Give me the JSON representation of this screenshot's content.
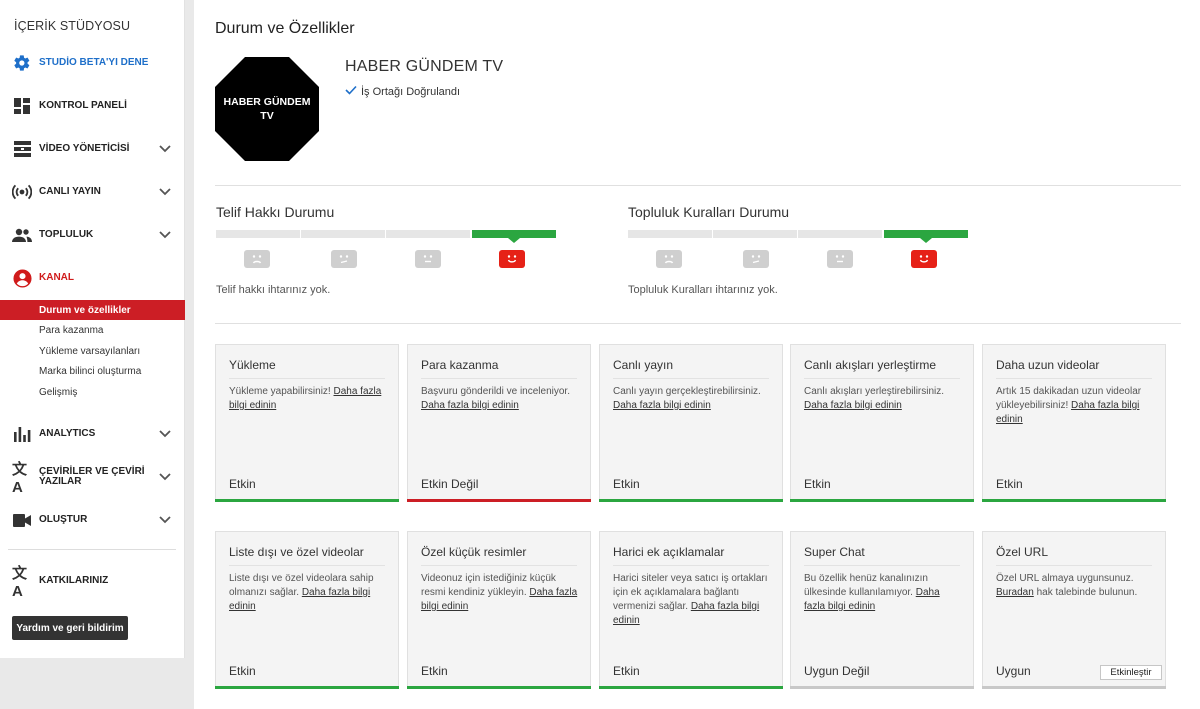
{
  "sidebar": {
    "title": "İÇERİK STÜDYOSU",
    "beta": "STUDİO BETA'YI DENE",
    "dashboard": "KONTROL PANELİ",
    "video_manager": "VİDEO YÖNETİCİSİ",
    "live": "CANLI YAYIN",
    "community": "TOPLULUK",
    "channel": "KANAL",
    "channel_sub": [
      "Durum ve özellikler",
      "Para kazanma",
      "Yükleme varsayılanları",
      "Marka bilinci oluşturma",
      "Gelişmiş"
    ],
    "analytics": "ANALYTICS",
    "translations_line1": "ÇEVİRİLER VE ÇEVİRİ",
    "translations_line2": "YAZILAR",
    "create": "OLUŞTUR",
    "contributions": "KATKILARINIZ",
    "help_button": "Yardım ve geri bildirim"
  },
  "page": {
    "title": "Durum ve Özellikler",
    "channel_name": "HABER GÜNDEM TV",
    "avatar_text": "HABER GÜNDEM TV",
    "verified": "İş Ortağı Doğrulandı"
  },
  "copyright": {
    "title": "Telif Hakkı Durumu",
    "message": "Telif hakkı ihtarınız yok.",
    "level": 4
  },
  "community": {
    "title": "Topluluk Kuralları Durumu",
    "message": "Topluluk Kuralları ihtarınız yok.",
    "level": 4
  },
  "colors": {
    "active_green": "#2ba640",
    "inactive_red": "#cc1e25",
    "face_red": "#e62117",
    "link_blue": "#1e6fc9"
  },
  "cards": [
    {
      "title": "Yükleme",
      "desc": "Yükleme yapabilirsiniz! ",
      "link": "Daha fazla bilgi edinin",
      "tail": "",
      "status": "Etkin",
      "state": "green"
    },
    {
      "title": "Para kazanma",
      "desc": "Başvuru gönderildi ve inceleniyor. ",
      "link": "Daha fazla bilgi edinin",
      "tail": "",
      "status": "Etkin Değil",
      "state": "red"
    },
    {
      "title": "Canlı yayın",
      "desc": "Canlı yayın gerçekleştirebilirsiniz. ",
      "link": "Daha fazla bilgi edinin",
      "tail": "",
      "status": "Etkin",
      "state": "green"
    },
    {
      "title": "Canlı akışları yerleştirme",
      "desc": "Canlı akışları yerleştirebilirsiniz. ",
      "link": "Daha fazla bilgi edinin",
      "tail": "",
      "status": "Etkin",
      "state": "green"
    },
    {
      "title": "Daha uzun videolar",
      "desc": "Artık 15 dakikadan uzun videolar yükleyebilirsiniz! ",
      "link": "Daha fazla bilgi edinin",
      "tail": "",
      "status": "Etkin",
      "state": "green"
    },
    {
      "title": "Liste dışı ve özel videolar",
      "desc": "Liste dışı ve özel videolara sahip olmanızı sağlar. ",
      "link": "Daha fazla bilgi edinin",
      "tail": "",
      "status": "Etkin",
      "state": "green"
    },
    {
      "title": "Özel küçük resimler",
      "desc": "Videonuz için istediğiniz küçük resmi kendiniz yükleyin. ",
      "link": "Daha fazla bilgi edinin",
      "tail": "",
      "status": "Etkin",
      "state": "green"
    },
    {
      "title": "Harici ek açıklamalar",
      "desc": "Harici siteler veya satıcı iş ortakları için ek açıklamalara bağlantı vermenizi sağlar. ",
      "link": "Daha fazla bilgi edinin",
      "tail": "",
      "status": "Etkin",
      "state": "green"
    },
    {
      "title": "Super Chat",
      "desc": "Bu özellik henüz kanalınızın ülkesinde kullanılamıyor. ",
      "link": "Daha fazla bilgi edinin",
      "tail": "",
      "status": "Uygun Değil",
      "state": "gray"
    },
    {
      "title": "Özel URL",
      "desc": "Özel URL almaya uygunsunuz. ",
      "link": "Buradan",
      "tail": " hak talebinde bulunun.",
      "status": "Uygun",
      "state": "gray",
      "button": "Etkinleştir"
    }
  ]
}
